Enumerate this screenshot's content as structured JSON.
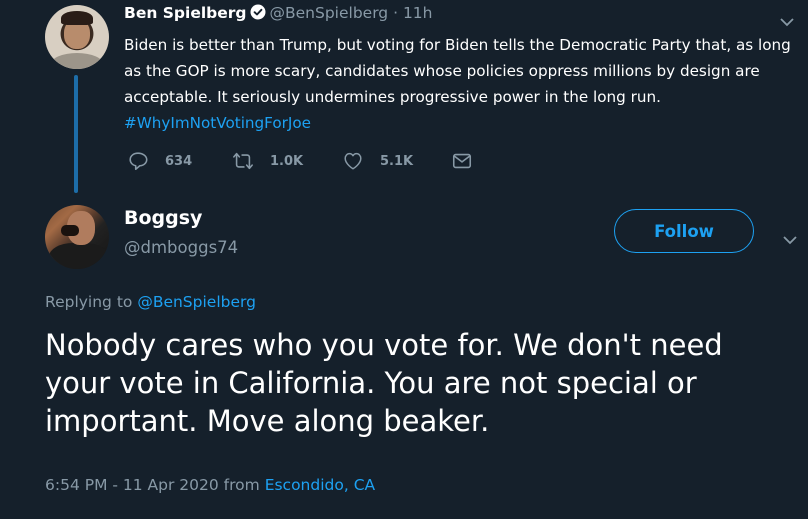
{
  "parent_tweet": {
    "author_name": "Ben Spielberg",
    "verified": true,
    "handle": "@BenSpielberg",
    "separator": " · ",
    "time_ago": "11h",
    "text": "Biden is better than Trump, but voting for Biden tells the Democratic Party that, as long as the GOP is more scary, candidates whose policies oppress millions by design are acceptable. It seriously undermines progressive power in the long run.",
    "hashtag": "#WhyImNotVotingForJoe",
    "actions": {
      "reply": {
        "icon": "reply-icon",
        "count": "634"
      },
      "retweet": {
        "icon": "retweet-icon",
        "count": "1.0K"
      },
      "like": {
        "icon": "heart-icon",
        "count": "5.1K"
      },
      "dm": {
        "icon": "envelope-icon"
      }
    }
  },
  "reply_tweet": {
    "author_name": "Boggsy",
    "handle": "@dmboggs74",
    "follow_label": "Follow",
    "replying_to_prefix": "Replying to ",
    "replying_to_handle": "@BenSpielberg",
    "text": "Nobody cares who you vote for. We don't need your vote in California. You are not special or important. Move along beaker.",
    "timestamp": "6:54 PM - 11 Apr 2020",
    "from_label": " from ",
    "location": "Escondido, CA"
  },
  "colors": {
    "background": "#15202b",
    "accent": "#1da1f2",
    "secondary_text": "#8899a6",
    "thread_line": "#1d6da8"
  }
}
